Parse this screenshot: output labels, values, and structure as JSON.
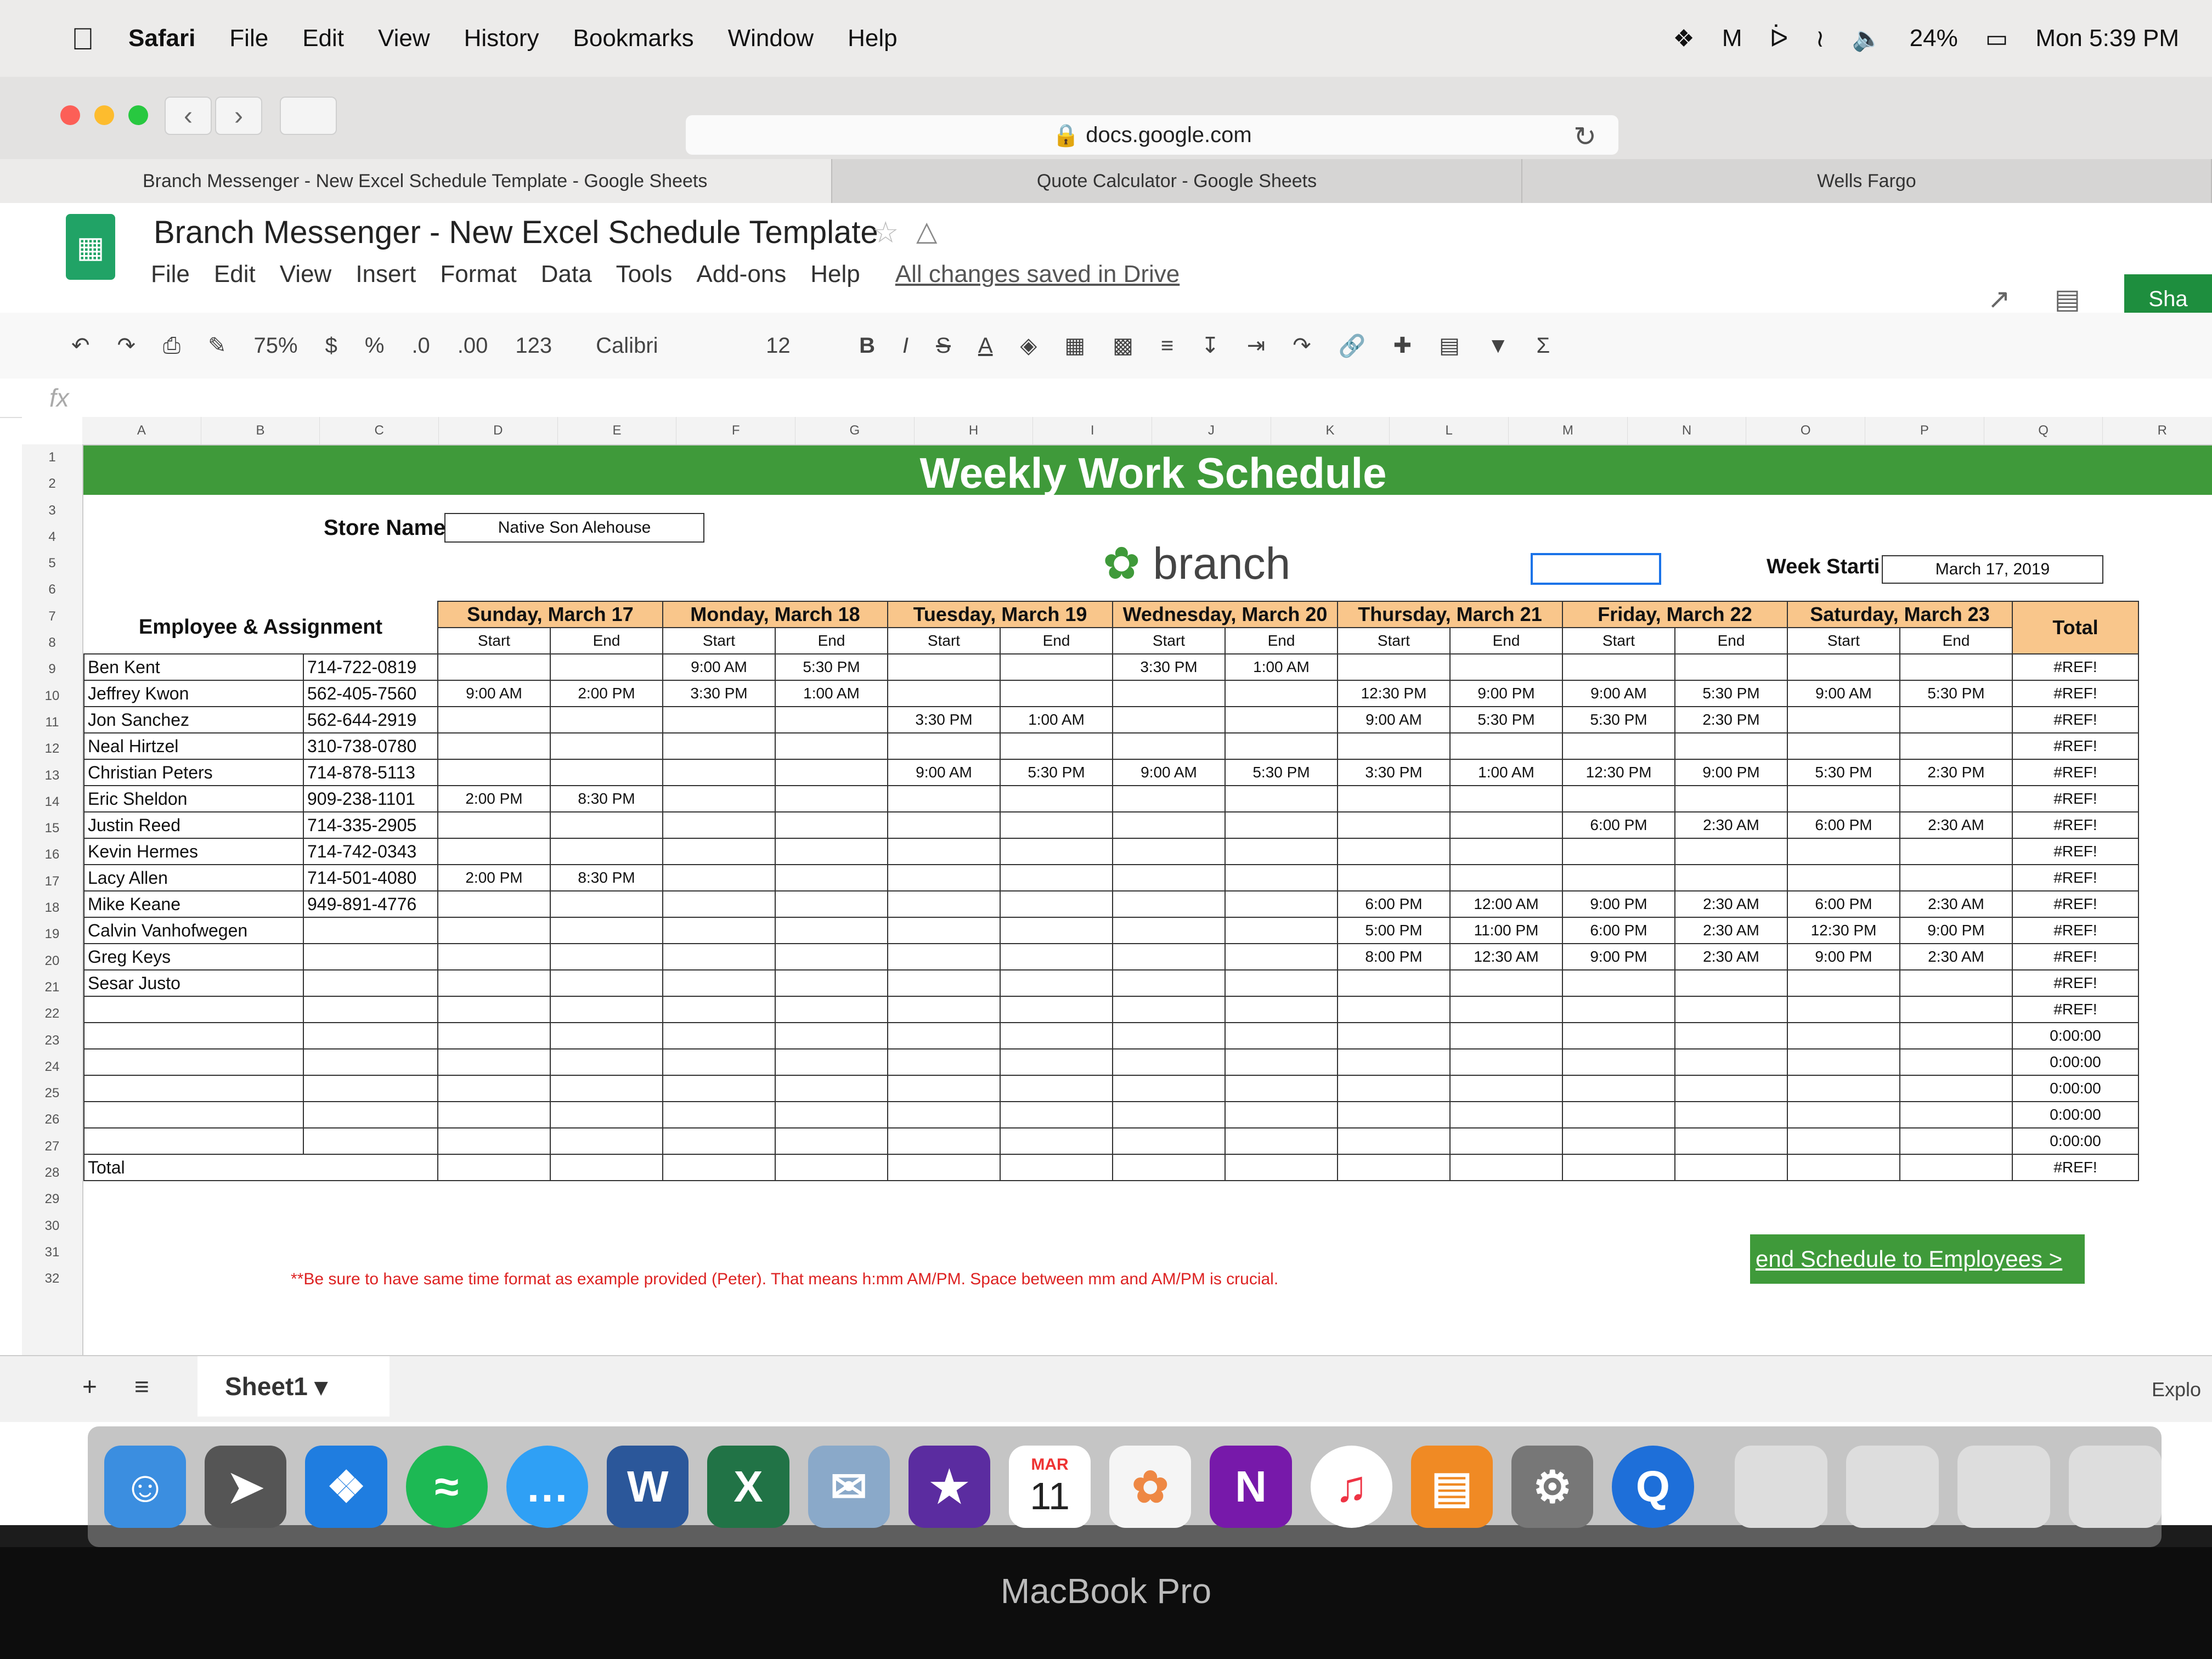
{
  "menubar": {
    "app": "Safari",
    "items": [
      "File",
      "Edit",
      "View",
      "History",
      "Bookmarks",
      "Window",
      "Help"
    ],
    "battery": "24%",
    "clock": "Mon 5:39 PM"
  },
  "browser": {
    "url": "docs.google.com",
    "tabs": [
      "Branch Messenger - New Excel Schedule Template - Google Sheets",
      "Quote Calculator - Google Sheets",
      "Wells Fargo"
    ]
  },
  "sheets": {
    "title": "Branch Messenger - New Excel Schedule Template",
    "menu": [
      "File",
      "Edit",
      "View",
      "Insert",
      "Format",
      "Data",
      "Tools",
      "Add-ons",
      "Help"
    ],
    "saved_status": "All changes saved in Drive",
    "share_label": "Sha",
    "fx": "fx"
  },
  "format_toolbar": {
    "zoom": "75%",
    "currency": "$",
    "percent": "%",
    "dec_less": ".0",
    "dec_more": ".00",
    "more_formats": "123",
    "font": "Calibri",
    "size": "12",
    "bold": "B",
    "italic": "I",
    "strike": "S",
    "text_color": "A"
  },
  "columns": [
    "A",
    "B",
    "C",
    "D",
    "E",
    "F",
    "G",
    "H",
    "I",
    "J",
    "K",
    "L",
    "M",
    "N",
    "O",
    "P",
    "Q",
    "R"
  ],
  "rows": [
    "1",
    "2",
    "3",
    "4",
    "5",
    "6",
    "7",
    "8",
    "9",
    "10",
    "11",
    "12",
    "13",
    "14",
    "15",
    "16",
    "17",
    "18",
    "19",
    "20",
    "21",
    "22",
    "23",
    "24",
    "25",
    "26",
    "27",
    "28",
    "29",
    "30",
    "31",
    "32"
  ],
  "schedule": {
    "banner": "Weekly Work Schedule",
    "store_label": "Store Name",
    "store_name": "Native Son Alehouse",
    "brand": "branch",
    "week_label": "Week Starti",
    "week_start": "March 17, 2019",
    "employee_header": "Employee & Assignment",
    "start_label": "Start",
    "end_label": "End",
    "total_header": "Total",
    "days": [
      "Sunday, March 17",
      "Monday, March 18",
      "Tuesday, March 19",
      "Wednesday, March 20",
      "Thursday, March 21",
      "Friday, March 22",
      "Saturday, March 23"
    ],
    "employees": [
      {
        "name": "Ben Kent",
        "phone": "714-722-0819",
        "times": [
          "",
          "",
          "9:00 AM",
          "5:30 PM",
          "",
          "",
          "3:30 PM",
          "1:00 AM",
          "",
          "",
          "",
          "",
          "",
          ""
        ],
        "total": "#REF!"
      },
      {
        "name": "Jeffrey Kwon",
        "phone": "562-405-7560",
        "times": [
          "9:00 AM",
          "2:00 PM",
          "3:30 PM",
          "1:00 AM",
          "",
          "",
          "",
          "",
          "12:30 PM",
          "9:00 PM",
          "9:00 AM",
          "5:30 PM",
          "9:00 AM",
          "5:30 PM"
        ],
        "total": "#REF!"
      },
      {
        "name": "Jon Sanchez",
        "phone": "562-644-2919",
        "times": [
          "",
          "",
          "",
          "",
          "3:30 PM",
          "1:00 AM",
          "",
          "",
          "9:00 AM",
          "5:30 PM",
          "5:30 PM",
          "2:30 PM",
          "",
          ""
        ],
        "total": "#REF!"
      },
      {
        "name": "Neal Hirtzel",
        "phone": "310-738-0780",
        "times": [
          "",
          "",
          "",
          "",
          "",
          "",
          "",
          "",
          "",
          "",
          "",
          "",
          "",
          ""
        ],
        "total": "#REF!"
      },
      {
        "name": "Christian Peters",
        "phone": "714-878-5113",
        "times": [
          "",
          "",
          "",
          "",
          "9:00 AM",
          "5:30 PM",
          "9:00 AM",
          "5:30 PM",
          "3:30 PM",
          "1:00 AM",
          "12:30 PM",
          "9:00 PM",
          "5:30 PM",
          "2:30 PM"
        ],
        "total": "#REF!"
      },
      {
        "name": "Eric Sheldon",
        "phone": "909-238-1101",
        "times": [
          "2:00 PM",
          "8:30 PM",
          "",
          "",
          "",
          "",
          "",
          "",
          "",
          "",
          "",
          "",
          "",
          ""
        ],
        "total": "#REF!"
      },
      {
        "name": "Justin Reed",
        "phone": "714-335-2905",
        "times": [
          "",
          "",
          "",
          "",
          "",
          "",
          "",
          "",
          "",
          "",
          "6:00 PM",
          "2:30 AM",
          "6:00 PM",
          "2:30 AM"
        ],
        "total": "#REF!"
      },
      {
        "name": "Kevin Hermes",
        "phone": "714-742-0343",
        "times": [
          "",
          "",
          "",
          "",
          "",
          "",
          "",
          "",
          "",
          "",
          "",
          "",
          "",
          ""
        ],
        "total": "#REF!"
      },
      {
        "name": "Lacy Allen",
        "phone": "714-501-4080",
        "times": [
          "2:00 PM",
          "8:30 PM",
          "",
          "",
          "",
          "",
          "",
          "",
          "",
          "",
          "",
          "",
          "",
          ""
        ],
        "total": "#REF!"
      },
      {
        "name": "Mike Keane",
        "phone": "949-891-4776",
        "times": [
          "",
          "",
          "",
          "",
          "",
          "",
          "",
          "",
          "6:00 PM",
          "12:00 AM",
          "9:00 PM",
          "2:30 AM",
          "6:00 PM",
          "2:30 AM"
        ],
        "total": "#REF!"
      },
      {
        "name": "Calvin Vanhofwegen",
        "phone": "",
        "times": [
          "",
          "",
          "",
          "",
          "",
          "",
          "",
          "",
          "5:00 PM",
          "11:00 PM",
          "6:00 PM",
          "2:30 AM",
          "12:30 PM",
          "9:00 PM"
        ],
        "total": "#REF!"
      },
      {
        "name": "Greg Keys",
        "phone": "",
        "times": [
          "",
          "",
          "",
          "",
          "",
          "",
          "",
          "",
          "8:00 PM",
          "12:30 AM",
          "9:00 PM",
          "2:30 AM",
          "9:00 PM",
          "2:30 AM"
        ],
        "total": "#REF!"
      },
      {
        "name": "Sesar Justo",
        "phone": "",
        "times": [
          "",
          "",
          "",
          "",
          "",
          "",
          "",
          "",
          "",
          "",
          "",
          "",
          "",
          ""
        ],
        "total": "#REF!"
      },
      {
        "name": "",
        "phone": "",
        "times": [
          "",
          "",
          "",
          "",
          "",
          "",
          "",
          "",
          "",
          "",
          "",
          "",
          "",
          ""
        ],
        "total": "#REF!"
      },
      {
        "name": "",
        "phone": "",
        "times": [
          "",
          "",
          "",
          "",
          "",
          "",
          "",
          "",
          "",
          "",
          "",
          "",
          "",
          ""
        ],
        "total": "0:00:00"
      },
      {
        "name": "",
        "phone": "",
        "times": [
          "",
          "",
          "",
          "",
          "",
          "",
          "",
          "",
          "",
          "",
          "",
          "",
          "",
          ""
        ],
        "total": "0:00:00"
      },
      {
        "name": "",
        "phone": "",
        "times": [
          "",
          "",
          "",
          "",
          "",
          "",
          "",
          "",
          "",
          "",
          "",
          "",
          "",
          ""
        ],
        "total": "0:00:00"
      },
      {
        "name": "",
        "phone": "",
        "times": [
          "",
          "",
          "",
          "",
          "",
          "",
          "",
          "",
          "",
          "",
          "",
          "",
          "",
          ""
        ],
        "total": "0:00:00"
      },
      {
        "name": "",
        "phone": "",
        "times": [
          "",
          "",
          "",
          "",
          "",
          "",
          "",
          "",
          "",
          "",
          "",
          "",
          "",
          ""
        ],
        "total": "0:00:00"
      }
    ],
    "total_row_label": "Total",
    "grand_total": "#REF!",
    "note": "**Be sure to have same time format as example provided (Peter). That means h:mm AM/PM. Space between mm and AM/PM is crucial.",
    "send_button": "end Schedule to Employees >"
  },
  "sheetbar": {
    "tab": "Sheet1",
    "explore": "Explo"
  },
  "dock": {
    "calendar_month": "MAR",
    "calendar_day": "11"
  },
  "bezel_label": "MacBook Pro",
  "colors": {
    "banner_green": "#3f9a3a",
    "day_header_orange": "#f9c68b",
    "note_red": "#dd2222"
  }
}
